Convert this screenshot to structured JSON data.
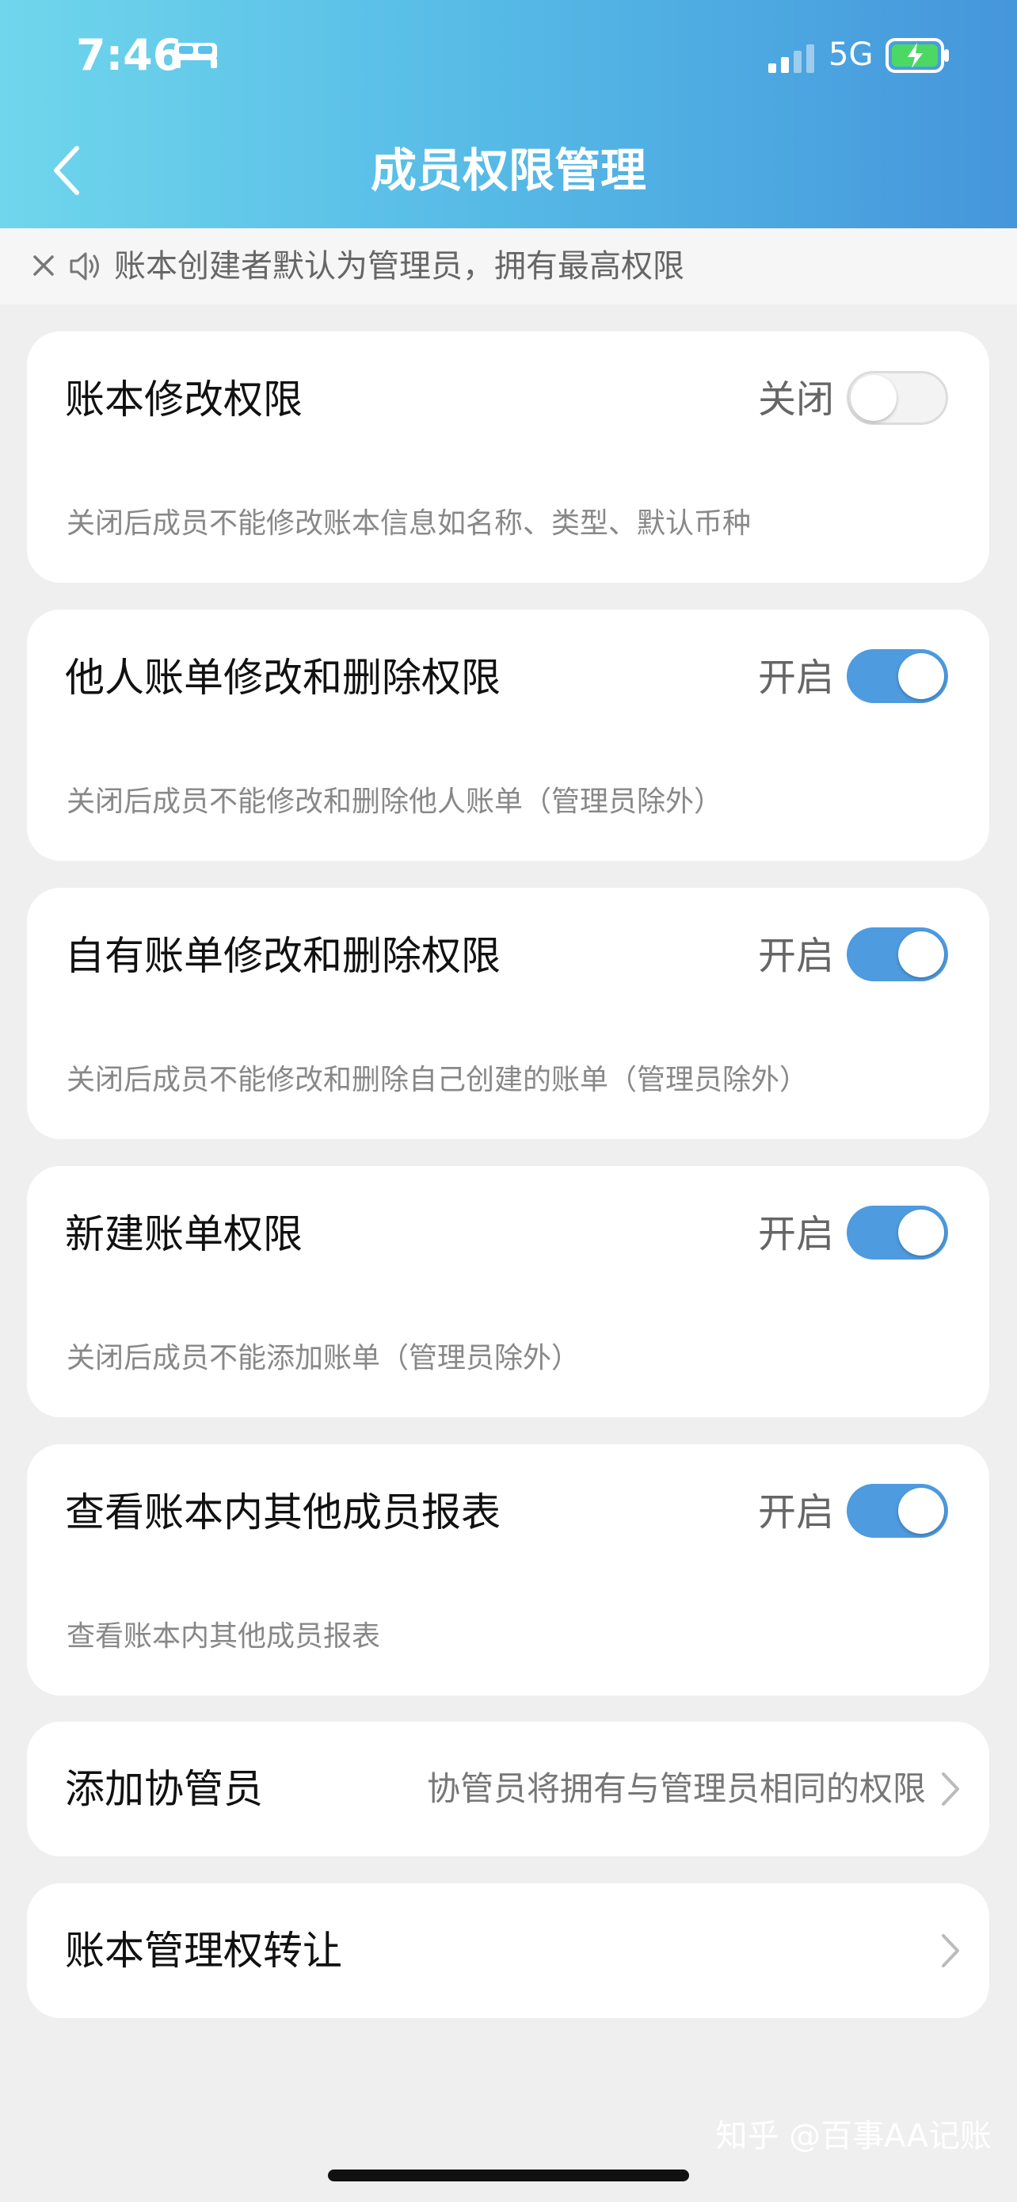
{
  "status_bar": {
    "time": "7:46",
    "network": "5G",
    "icons": [
      "bed-icon",
      "signal-icon",
      "battery-charging-icon"
    ]
  },
  "header": {
    "title": "成员权限管理",
    "back_icon": "chevron-left-icon"
  },
  "notice": {
    "text": "账本创建者默认为管理员，拥有最高权限",
    "close_icon": "close-icon",
    "speaker_icon": "speaker-icon"
  },
  "permissions": [
    {
      "title": "账本修改权限",
      "status": "关闭",
      "enabled": false,
      "desc": "关闭后成员不能修改账本信息如名称、类型、默认币种"
    },
    {
      "title": "他人账单修改和删除权限",
      "status": "开启",
      "enabled": true,
      "desc": "关闭后成员不能修改和删除他人账单（管理员除外）"
    },
    {
      "title": "自有账单修改和删除权限",
      "status": "开启",
      "enabled": true,
      "desc": "关闭后成员不能修改和删除自己创建的账单（管理员除外）"
    },
    {
      "title": "新建账单权限",
      "status": "开启",
      "enabled": true,
      "desc": "关闭后成员不能添加账单（管理员除外）"
    },
    {
      "title": "查看账本内其他成员报表",
      "status": "开启",
      "enabled": true,
      "desc": "查看账本内其他成员报表"
    }
  ],
  "links": [
    {
      "title": "添加协管员",
      "subtitle": "协管员将拥有与管理员相同的权限"
    },
    {
      "title": "账本管理权转让",
      "subtitle": ""
    }
  ],
  "watermark": "知乎 @百事AA记账",
  "colors": {
    "header_start": "#6fd6ec",
    "header_end": "#4596db",
    "toggle_on": "#4e9be0",
    "background": "#efefef"
  }
}
